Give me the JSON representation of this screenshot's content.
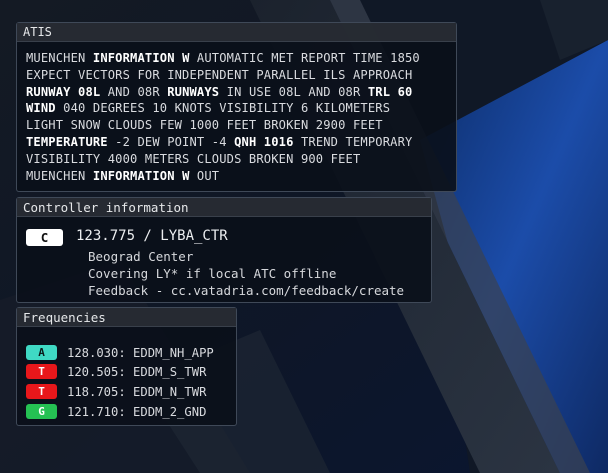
{
  "colors": {
    "approach": "#3fd9c4",
    "tower": "#e8171b",
    "ground": "#25c153",
    "center": "#ffffff"
  },
  "atis": {
    "title": "ATIS",
    "lines": [
      [
        {
          "t": "MUENCHEN "
        },
        {
          "t": "INFORMATION W",
          "b": true
        },
        {
          "t": " AUTOMATIC MET REPORT TIME 1850"
        }
      ],
      [
        {
          "t": "EXPECT VECTORS FOR INDEPENDENT PARALLEL ILS APPROACH"
        }
      ],
      [
        {
          "t": "RUNWAY 08L",
          "b": true
        },
        {
          "t": " AND 08R "
        },
        {
          "t": "RUNWAYS",
          "b": true
        },
        {
          "t": " IN USE 08L AND 08R "
        },
        {
          "t": "TRL 60",
          "b": true
        }
      ],
      [
        {
          "t": "WIND",
          "b": true
        },
        {
          "t": " 040 DEGREES 10 KNOTS VISIBILITY 6 KILOMETERS"
        }
      ],
      [
        {
          "t": "LIGHT SNOW CLOUDS FEW 1000 FEET BROKEN 2900 FEET"
        }
      ],
      [
        {
          "t": "TEMPERATURE",
          "b": true
        },
        {
          "t": " -2 DEW POINT -4 "
        },
        {
          "t": "QNH 1016",
          "b": true
        },
        {
          "t": " TREND TEMPORARY"
        }
      ],
      [
        {
          "t": "VISIBILITY 4000 METERS CLOUDS BROKEN 900 FEET"
        }
      ],
      [
        {
          "t": "MUENCHEN "
        },
        {
          "t": "INFORMATION W",
          "b": true
        },
        {
          "t": " OUT"
        }
      ]
    ]
  },
  "controller": {
    "title": "Controller information",
    "badge": "C",
    "frequency_callsign": "123.775 / LYBA_CTR",
    "lines": [
      "Beograd Center",
      "Covering LY* if local ATC offline",
      "Feedback - cc.vatadria.com/feedback/create"
    ]
  },
  "frequencies": {
    "title": "Frequencies",
    "items": [
      {
        "badge": "A",
        "text": "128.030: EDDM_NH_APP",
        "color_key": "approach",
        "text_color": "#0b1a1a"
      },
      {
        "badge": "T",
        "text": "120.505: EDDM_S_TWR",
        "color_key": "tower",
        "text_color": "#ffffff"
      },
      {
        "badge": "T",
        "text": "118.705: EDDM_N_TWR",
        "color_key": "tower",
        "text_color": "#ffffff"
      },
      {
        "badge": "G",
        "text": "121.710: EDDM_2_GND",
        "color_key": "ground",
        "text_color": "#ffffff"
      }
    ]
  }
}
